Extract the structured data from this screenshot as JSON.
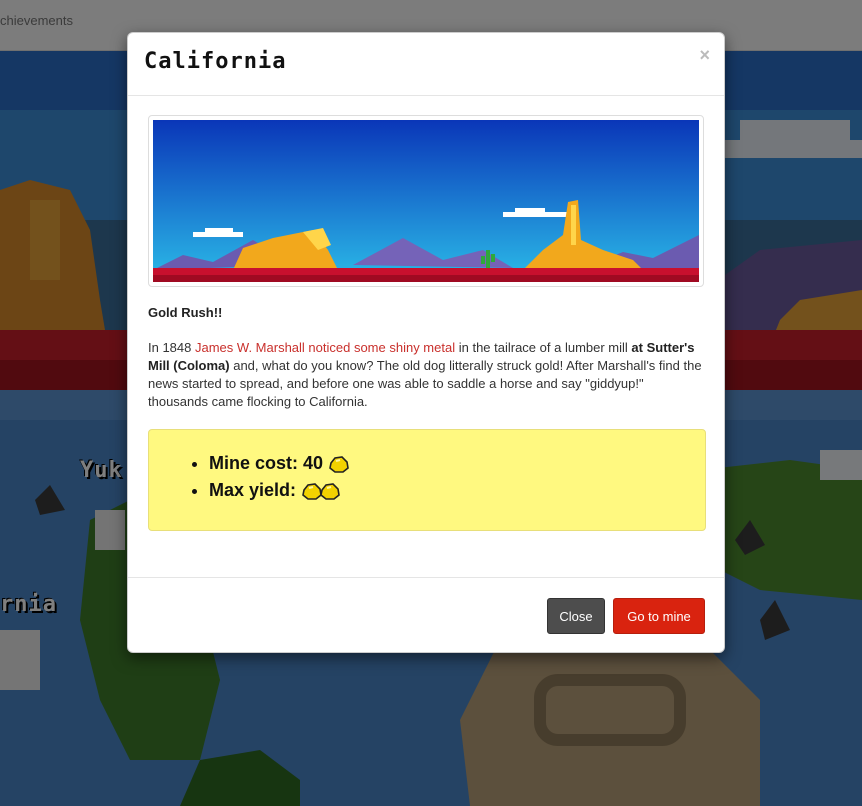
{
  "topbar": {
    "nav_text": "chievements"
  },
  "map": {
    "labels": [
      "Yuk",
      "rnia"
    ]
  },
  "modal": {
    "title": "California",
    "close_symbol": "×",
    "heading": "Gold Rush!!",
    "story": {
      "intro": "In 1848 ",
      "link": "James W. Marshall noticed some shiny metal",
      "mid": " in the tailrace of a lumber mill ",
      "bold": "at Sutter's Mill (Coloma)",
      "rest": " and, what do you know? The old dog litterally struck gold! After Marshall's find the news started to spread, and before one was able to saddle a horse and say \"giddyup!\" thousands came flocking to California."
    },
    "stats": {
      "mine_cost_label": "Mine cost: 40",
      "mine_cost_icon": "gold-nugget",
      "max_yield_label": "Max yield:",
      "max_yield_icons": 2
    },
    "buttons": {
      "close": "Close",
      "go": "Go to mine"
    }
  },
  "colors": {
    "accent_red": "#d9230f",
    "highlight_yellow": "#fff980",
    "dark_button": "#4d4d4d",
    "link_red": "#c9302c"
  }
}
